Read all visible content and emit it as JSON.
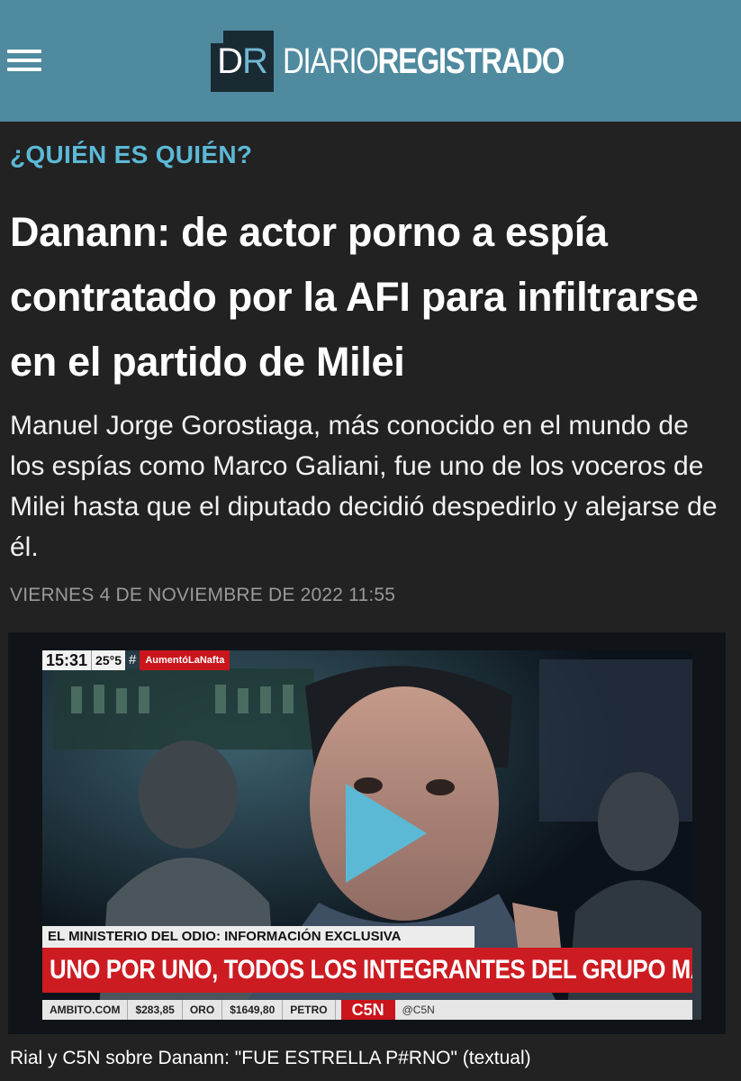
{
  "header": {
    "menu_icon": "hamburger-menu-icon",
    "brand_color": "#4f8a9f",
    "logo": {
      "mark_d": "D",
      "mark_r": "R",
      "name_light": "DIARIO",
      "name_bold": "REGISTRADO"
    }
  },
  "article": {
    "kicker": "¿QUIÉN ES QUIÉN?",
    "headline": "Danann: de actor porno a espía contratado por la AFI para infiltrarse en el partido de Milei",
    "summary": "Manuel Jorge Gorostiaga, más conocido en el mundo de los espías como Marco Galiani, fue uno de los voceros de Milei hasta que el diputado decidió despedirlo y alejarse de él.",
    "date": "VIERNES 4 DE NOVIEMBRE DE 2022 11:55"
  },
  "video": {
    "play_icon": "play-icon",
    "accent_color": "#5bb9d6",
    "tv_bug": {
      "time": "15:31",
      "temperature": "25°5",
      "hash": "#",
      "tag": "AumentóLaNafta"
    },
    "lower_third": {
      "top": "EL MINISTERIO DEL ODIO: INFORMACIÓN EXCLUSIVA",
      "main": "UNO POR UNO, TODOS LOS INTEGRANTES DEL GRUPO MÁS VIOLENTO"
    },
    "ticker": {
      "source": "AMBITO.COM",
      "item1": "$283,85",
      "item2": "ORO",
      "item3": "$1649,80",
      "item4": "PETRO",
      "channel": "C5N",
      "handle": "@C5N"
    },
    "caption": "Rial y C5N sobre Danann: \"FUE ESTRELLA P#RNO\" (textual)"
  }
}
